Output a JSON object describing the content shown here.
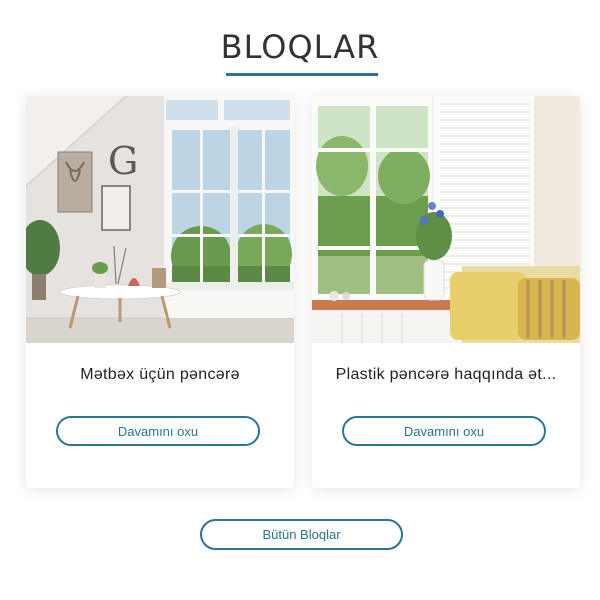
{
  "section": {
    "title": "BLOQLAR"
  },
  "cards": [
    {
      "title": "Mətbəx üçün pəncərə",
      "button_label": "Davamını oxu"
    },
    {
      "title": "Plastik pəncərə haqqında ət...",
      "button_label": "Davamını oxu"
    }
  ],
  "all_blogs_label": "Bütün Bloqlar",
  "colors": {
    "accent": "#2a7496",
    "text": "#222222"
  }
}
